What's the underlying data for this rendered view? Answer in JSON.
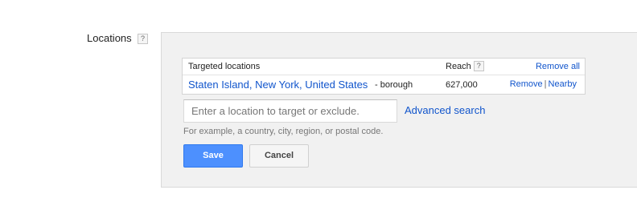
{
  "section": {
    "label": "Locations",
    "help_glyph": "?"
  },
  "table": {
    "header_targeted": "Targeted locations",
    "header_reach": "Reach",
    "header_reach_help": "?",
    "remove_all": "Remove all",
    "rows": [
      {
        "name": "Staten Island, New York, United States",
        "type": "- borough",
        "reach": "627,000",
        "remove": "Remove",
        "separator": "|",
        "nearby": "Nearby"
      }
    ]
  },
  "search": {
    "placeholder": "Enter a location to target or exclude.",
    "value": "",
    "advanced_link": "Advanced search",
    "hint": "For example, a country, city, region, or postal code."
  },
  "buttons": {
    "save": "Save",
    "cancel": "Cancel"
  },
  "colors": {
    "link": "#1155cc",
    "primary_button": "#4d90fe",
    "panel_background": "#f1f1f1"
  }
}
